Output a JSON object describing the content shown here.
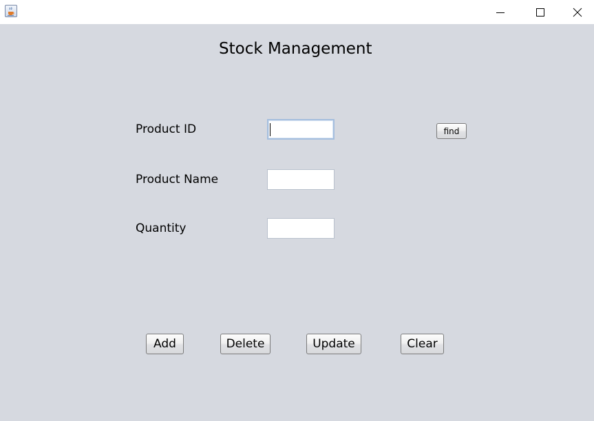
{
  "window": {
    "icon": "java-cup-icon",
    "controls": [
      "minimize",
      "maximize",
      "close"
    ]
  },
  "form": {
    "heading": "Stock Management",
    "fields": {
      "product_id": {
        "label": "Product ID",
        "value": ""
      },
      "product_name": {
        "label": "Product Name",
        "value": ""
      },
      "quantity": {
        "label": "Quantity",
        "value": ""
      }
    },
    "find_label": "find"
  },
  "actions": {
    "add_label": "Add",
    "delete_label": "Delete",
    "update_label": "Update",
    "clear_label": "Clear"
  },
  "colors": {
    "panel_background": "#d6d9e0",
    "titlebar_background": "#ffffff",
    "focus_border": "#a4bede"
  }
}
